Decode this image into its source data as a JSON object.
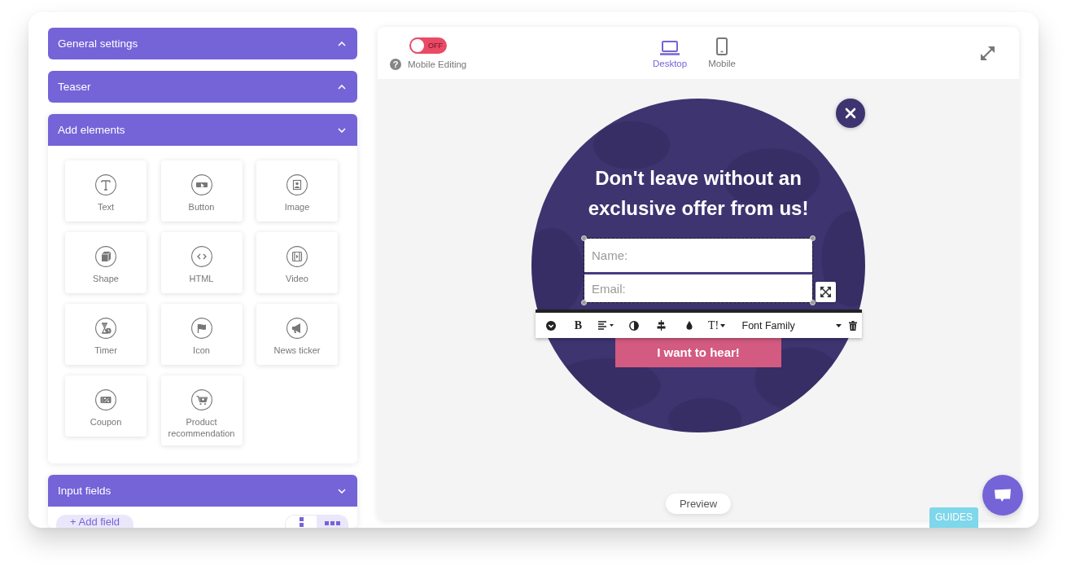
{
  "sidebar": {
    "sections": [
      {
        "title": "General settings",
        "expanded": false
      },
      {
        "title": "Teaser",
        "expanded": false
      },
      {
        "title": "Add elements",
        "expanded": true,
        "elements": [
          {
            "kind": "text",
            "label": "Text"
          },
          {
            "kind": "button",
            "label": "Button"
          },
          {
            "kind": "image",
            "label": "Image"
          },
          {
            "kind": "shape",
            "label": "Shape"
          },
          {
            "kind": "html",
            "label": "HTML"
          },
          {
            "kind": "video",
            "label": "Video"
          },
          {
            "kind": "timer",
            "label": "Timer"
          },
          {
            "kind": "icon",
            "label": "Icon"
          },
          {
            "kind": "news-ticker",
            "label": "News ticker"
          },
          {
            "kind": "coupon",
            "label": "Coupon"
          },
          {
            "kind": "product",
            "label": "Product recommendation"
          }
        ]
      },
      {
        "title": "Input fields",
        "expanded": true,
        "add_button": "+ Add field",
        "layouts": [
          {
            "kind": "vertical",
            "selected": false
          },
          {
            "kind": "horizontal",
            "selected": true
          }
        ]
      }
    ]
  },
  "editor": {
    "mobile_editing": {
      "on": false,
      "toggle_text": "OFF",
      "help": "?",
      "label": "Mobile Editing"
    },
    "devices": [
      {
        "kind": "desktop",
        "label": "Desktop",
        "selected": true
      },
      {
        "kind": "mobile",
        "label": "Mobile",
        "selected": false
      }
    ],
    "popup": {
      "headline": "Don't leave without an exclusive offer from us!",
      "form": {
        "selected": true,
        "fields": [
          {
            "placeholder": "Name:"
          },
          {
            "placeholder": "Email:"
          }
        ]
      },
      "toolbar": {
        "bold": "B",
        "text_size": "T!",
        "font_family": "Font Family"
      },
      "cta": "I want to hear!"
    },
    "preview": "Preview"
  },
  "guides": "GUIDES"
}
